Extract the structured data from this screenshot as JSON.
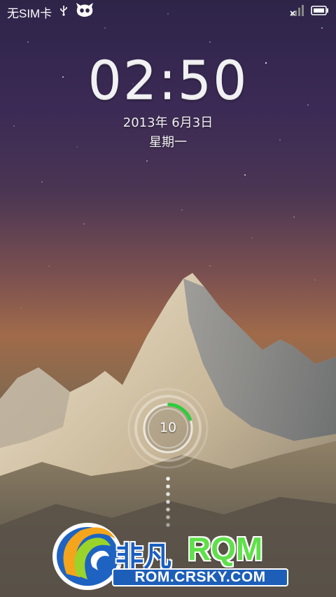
{
  "status_bar": {
    "carrier_text": "无SIM卡",
    "icons": [
      "usb-icon",
      "cyanogen-mascot-icon",
      "no-signal-icon",
      "battery-icon"
    ]
  },
  "lockscreen": {
    "time": "02:50",
    "date": "2013年 6月3日",
    "weekday": "星期一",
    "unlock_count": "10",
    "unlock_progress": 0.18,
    "accent_color": "#2ecc40"
  },
  "watermark": {
    "brand_cn": "非凡",
    "brand_en": "RQM",
    "url": "ROM.CRSKY.COM",
    "colors": {
      "blue": "#1a5fc0",
      "green": "#5fe04a"
    }
  }
}
